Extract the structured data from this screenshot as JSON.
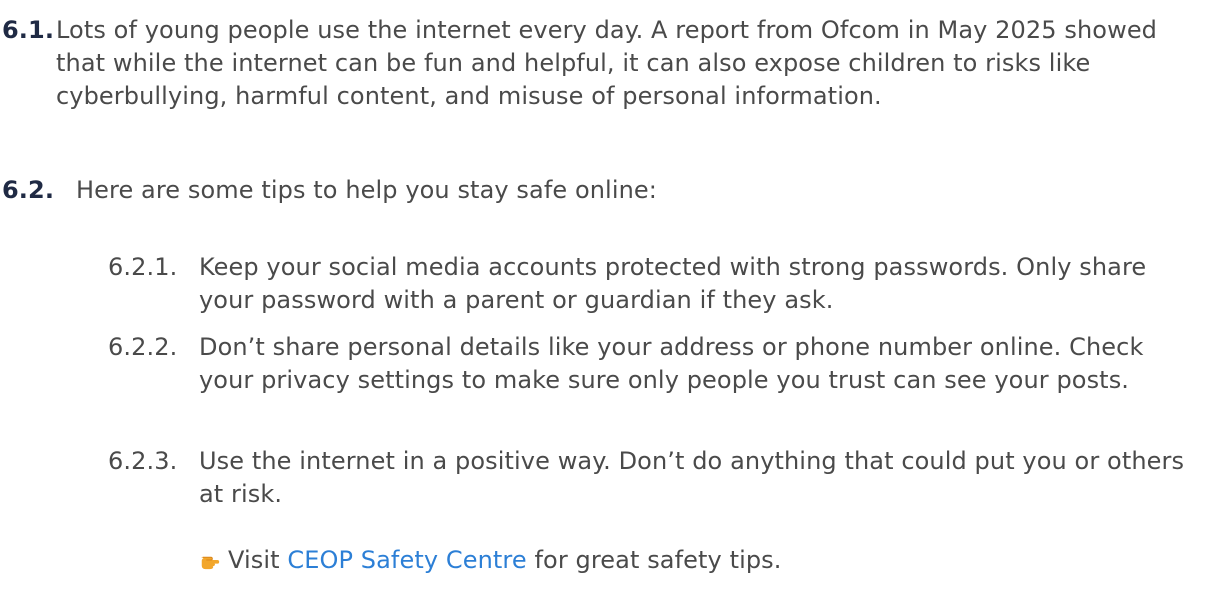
{
  "sections": [
    {
      "number": "6.1.",
      "text": "Lots of young people use the internet every day. A report from Ofcom in May 2025 showed that while the internet can be fun and helpful, it can also expose children to risks like cyberbullying, harmful content, and misuse of personal information."
    },
    {
      "number": "6.2.",
      "text": "Here are some tips to help you stay safe online:",
      "tips": [
        {
          "number": "6.2.1.",
          "text": "Keep your social media accounts protected with strong passwords. Only share your password with a parent or guardian if they ask."
        },
        {
          "number": "6.2.2.",
          "text": "Don’t share personal details like your address or phone number online. Check your privacy settings to make sure only people you trust can see your posts."
        },
        {
          "number": "6.2.3.",
          "text": "Use the internet in a positive way. Don’t do anything that could put you or others at risk."
        }
      ],
      "note": {
        "icon": "pointing-hand-icon",
        "prefix": "Visit",
        "link_text": "CEOP Safety Centre",
        "suffix": "for great safety tips."
      }
    }
  ],
  "colors": {
    "text": "#4a4a4a",
    "section_number": "#1f2a44",
    "link": "#2c7fd6",
    "icon": "#f2a62b"
  }
}
